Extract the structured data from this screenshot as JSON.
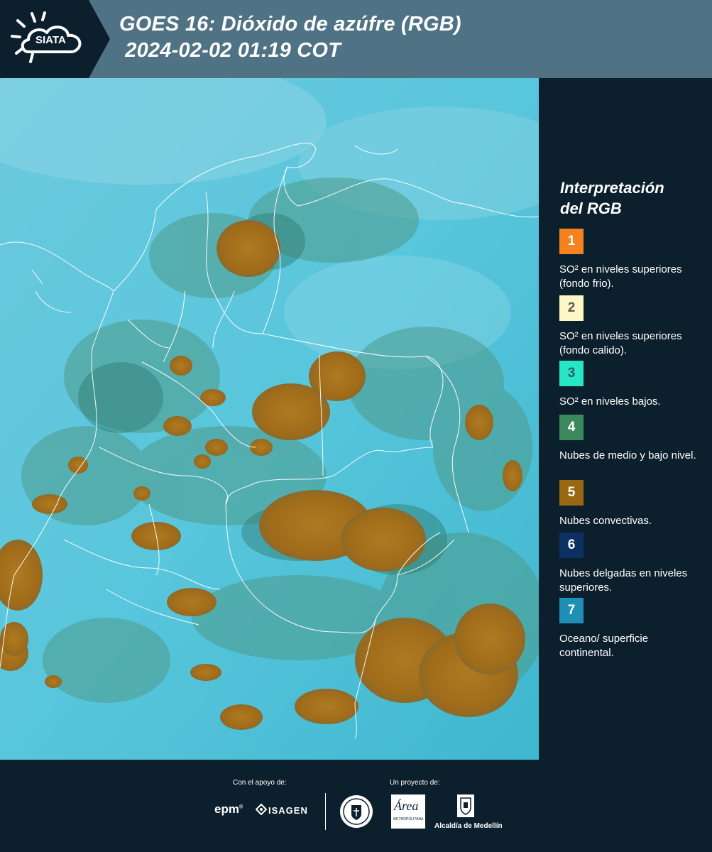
{
  "header": {
    "logo_text": "SIATA",
    "title_line1": "GOES 16: Dióxido de azúfre (RGB)",
    "title_line2": " 2024-02-02 01:19 COT",
    "background_color": "#4f7385"
  },
  "legend": {
    "title_line1": "Interpretación",
    "title_line2": "del RGB",
    "items": [
      {
        "number": "1",
        "color": "#f5821f",
        "text": "SO² en niveles superiores (fondo frio)."
      },
      {
        "number": "2",
        "color": "#fff8c6",
        "text": "SO² en niveles superiores (fondo calido)."
      },
      {
        "number": "3",
        "color": "#27e6c6",
        "text": "SO² en niveles bajos."
      },
      {
        "number": "4",
        "color": "#3a8a5e",
        "text": "Nubes de medio y bajo nivel."
      },
      {
        "number": "5",
        "color": "#9a6812",
        "text": "Nubes convectivas."
      },
      {
        "number": "6",
        "color": "#0d3063",
        "text": "Nubes delgadas en niveles superiores."
      },
      {
        "number": "7",
        "color": "#1f8fb5",
        "text": "Oceano/ superficie continental."
      }
    ]
  },
  "footer": {
    "support_caption": "Con el apoyo de:",
    "project_caption": "Un proyecto de:",
    "sponsor_epm": "epm",
    "sponsor_isagen": "ISAGEN",
    "partner_area": "Área",
    "partner_area_sub": "METROPOLITANA",
    "partner_alcaldia": "Alcaldía de Medellín"
  }
}
